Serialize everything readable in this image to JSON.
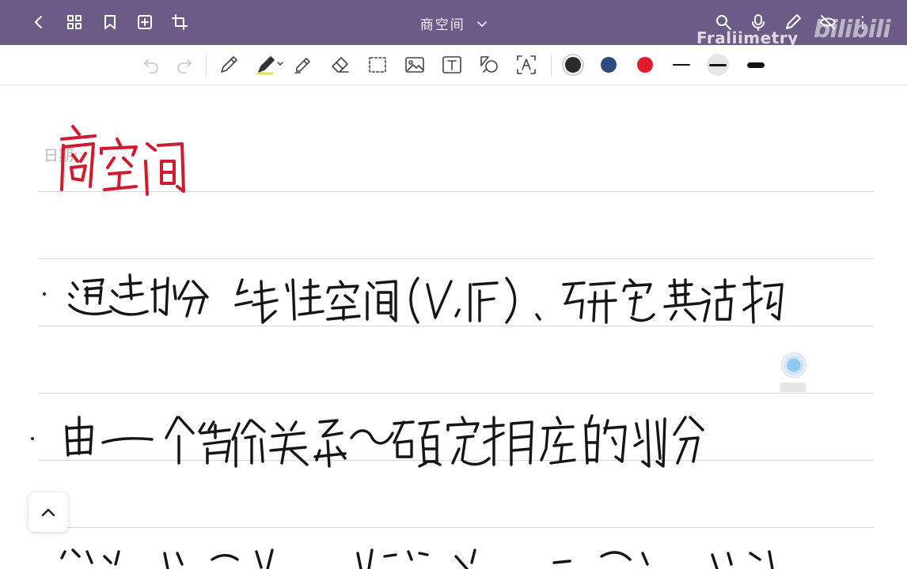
{
  "header": {
    "title": "商空间",
    "watermark": "Fraliimetry",
    "bili_logo": "bilibili",
    "bar_color": "#6b5b86",
    "left_icons": [
      "back-icon",
      "grid-icon",
      "bookmark-icon",
      "add-page-icon",
      "crop-icon"
    ],
    "right_icons": [
      "search-icon",
      "microphone-icon",
      "pencil-icon",
      "eye-off-icon",
      "more-icon"
    ]
  },
  "toolbar": {
    "tools": [
      "undo-icon",
      "redo-icon",
      "pen-icon",
      "highlighter-icon",
      "marker-icon",
      "eraser-icon",
      "lasso-icon",
      "image-icon",
      "text-icon",
      "shapes-icon",
      "ocr-icon"
    ],
    "colors": [
      "#2b2b2b",
      "#2f4a7e",
      "#e0192d"
    ],
    "selected_color": "#2b2b2b",
    "stroke_widths": [
      "thin",
      "medium",
      "thick"
    ],
    "selected_width": "medium"
  },
  "page": {
    "date_label": "日期:",
    "ink_title": "商空间",
    "ink_color_title": "#cf1a2f",
    "ink_color_body": "#151515",
    "lines": [
      "通过划分线性空间(V,F),研究其结构",
      "由一个等价关系~确定相应的划分"
    ]
  }
}
